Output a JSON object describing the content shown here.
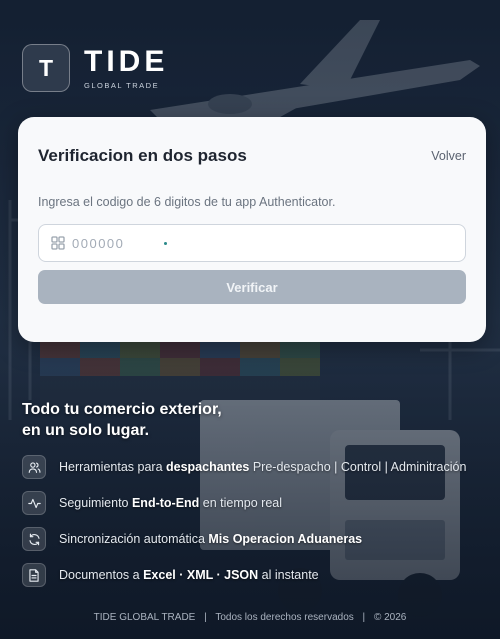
{
  "brand": {
    "logo_letter": "T",
    "name": "TIDE",
    "subtitle": "GLOBAL TRADE"
  },
  "card": {
    "title": "Verificacion en dos pasos",
    "back_label": "Volver",
    "description": "Ingresa el codigo de 6 digitos de tu app Authenticator.",
    "code_placeholder": "000000",
    "code_value": "",
    "verify_label": "Verificar"
  },
  "tagline": {
    "line1": "Todo tu comercio exterior,",
    "line2": "en un solo lugar."
  },
  "features": [
    {
      "icon": "users-icon",
      "pre": "Herramientas para ",
      "bold": "despachantes",
      "post": " Pre-despacho | Control | Adminitración"
    },
    {
      "icon": "activity-icon",
      "pre": "Seguimiento ",
      "bold": "End-to-End",
      "post": " en tiempo real"
    },
    {
      "icon": "refresh-icon",
      "pre": "Sincronización automática ",
      "bold": "Mis Operacion Aduaneras",
      "post": ""
    },
    {
      "icon": "document-icon",
      "pre": "Documentos a ",
      "bold": "Excel · XML · JSON",
      "post": " al instante"
    }
  ],
  "footer": {
    "company": "TIDE GLOBAL TRADE",
    "rights": "Todos los derechos reservados",
    "copyright": "© 2026",
    "separator": "|"
  },
  "colors": {
    "background": "#16243a",
    "card": "#f8f9fb",
    "button_disabled": "#a9b3bf",
    "text_muted": "#6b7480"
  }
}
